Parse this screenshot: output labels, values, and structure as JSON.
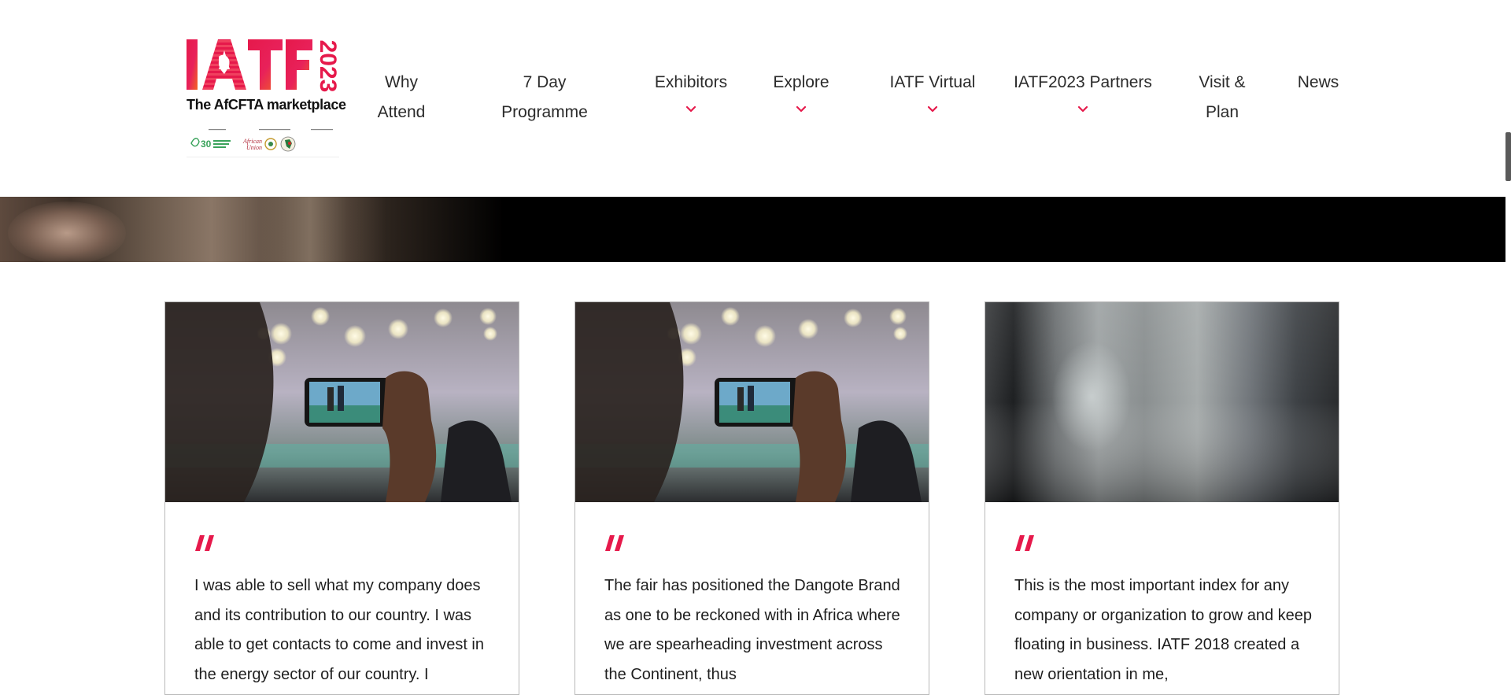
{
  "header": {
    "logo": {
      "wordmark": "IATF",
      "year": "2023",
      "tagline": "The AfCFTA marketplace",
      "partner_logos": [
        "30-years-afreximbank-logo",
        "african-union-logo",
        "afcfta-secretariat-logo"
      ]
    },
    "nav": [
      {
        "label_line1": "Why",
        "label_line2": "Attend",
        "has_dropdown": false
      },
      {
        "label_line1": "7 Day",
        "label_line2": "Programme",
        "has_dropdown": false
      },
      {
        "label_line1": "Exhibitors",
        "label_line2": "",
        "has_dropdown": true
      },
      {
        "label_line1": "Explore",
        "label_line2": "",
        "has_dropdown": true
      },
      {
        "label_line1": "IATF Virtual",
        "label_line2": "",
        "has_dropdown": true
      },
      {
        "label_line1": "IATF2023 Partners",
        "label_line2": "",
        "has_dropdown": true
      },
      {
        "label_line1": "Visit &",
        "label_line2": "Plan",
        "has_dropdown": false
      },
      {
        "label_line1": "News",
        "label_line2": "",
        "has_dropdown": false
      }
    ]
  },
  "testimonials": [
    {
      "image": "person-photographing-event-with-smartphone",
      "quote_icon": "quote-icon",
      "text": "I was able to sell what my company does and its contribution to our country. I was able to get contacts to come and invest in the energy sector of our country. I"
    },
    {
      "image": "person-photographing-event-with-smartphone",
      "quote_icon": "quote-icon",
      "text": "The fair has positioned the Dangote Brand as one to be reckoned with in Africa where we are spearheading investment across the Continent, thus"
    },
    {
      "image": "blurred-gray-abstract",
      "quote_icon": "quote-icon",
      "text": "This is the most important index for any company or organization to grow and keep floating in business. IATF 2018 created a new orientation in me,"
    }
  ],
  "colors": {
    "brand_pink": "#e6194b",
    "brand_orange": "#f26522",
    "text": "#1e1e1e",
    "card_border": "#b9b9b9"
  }
}
